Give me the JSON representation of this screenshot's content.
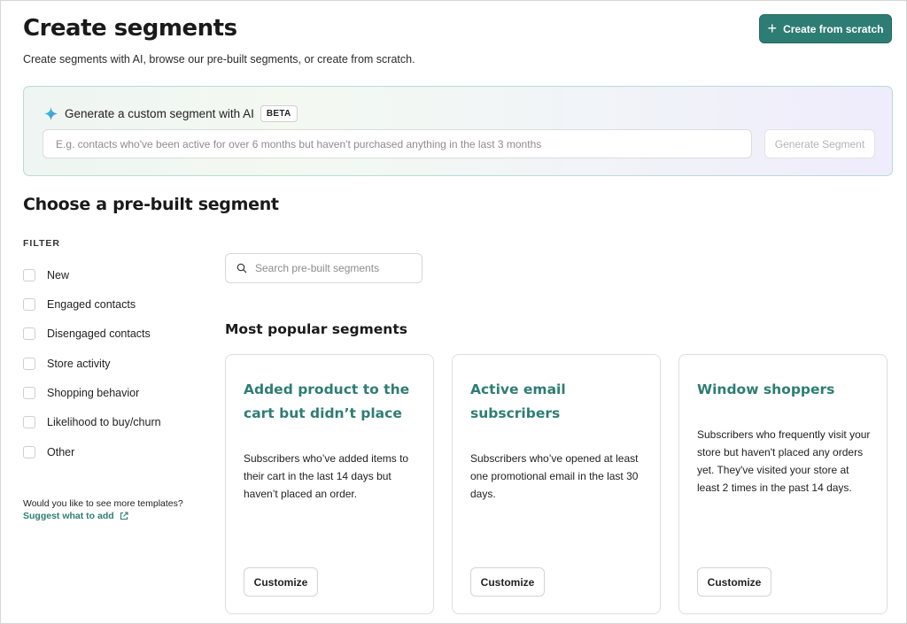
{
  "header": {
    "title": "Create segments",
    "subtitle": "Create segments with AI, browse our pre-built segments, or create from scratch.",
    "create_button_label": "Create from scratch"
  },
  "ai_panel": {
    "title": "Generate a custom segment with AI",
    "badge": "BETA",
    "input_placeholder": "E.g. contacts who've been active for over 6 months but haven't purchased anything in the last 3 months",
    "input_value": "",
    "generate_button_label": "Generate Segment"
  },
  "prebuilt": {
    "section_title": "Choose a pre-built segment",
    "filter_label": "FILTER",
    "filters": [
      {
        "label": "New",
        "checked": false
      },
      {
        "label": "Engaged contacts",
        "checked": false
      },
      {
        "label": "Disengaged contacts",
        "checked": false
      },
      {
        "label": "Store activity",
        "checked": false
      },
      {
        "label": "Shopping behavior",
        "checked": false
      },
      {
        "label": "Likelihood to buy/churn",
        "checked": false
      },
      {
        "label": "Other",
        "checked": false
      }
    ],
    "more_templates_question": "Would you like to see more templates?",
    "suggest_link_label": "Suggest what to add",
    "search_placeholder": "Search pre-built segments",
    "popular_title": "Most popular segments",
    "cards": [
      {
        "title": "Added product to the cart but didn’t place an order",
        "description": "Subscribers who’ve added items to their cart in the last 14 days but haven’t placed an order.",
        "button_label": "Customize"
      },
      {
        "title": "Active email subscribers",
        "description": "Subscribers who’ve opened at least one promotional email in the last 30 days.",
        "button_label": "Customize"
      },
      {
        "title": "Window shoppers",
        "description": "Subscribers who frequently visit your store but haven't placed any orders yet. They've visited your store at least 2 times in the past 14 days.",
        "button_label": "Customize"
      }
    ]
  },
  "colors": {
    "accent": "#2e7d74",
    "panel_border": "#b9dcd6",
    "text": "#1c1c1c"
  },
  "icons": {
    "create_button": "plus-icon",
    "ai": "sparkle-icon",
    "search": "search-icon",
    "suggest_link": "external-link-icon"
  }
}
